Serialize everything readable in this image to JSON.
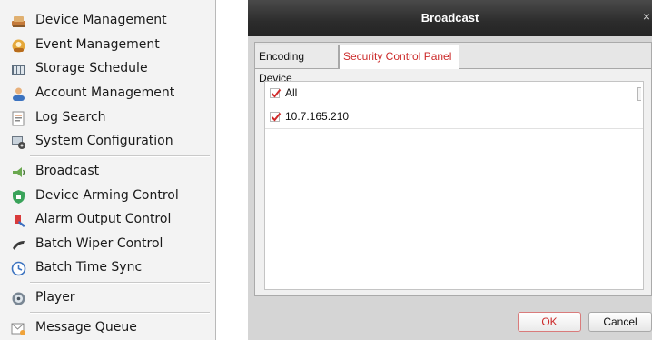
{
  "menu": {
    "items": [
      {
        "label": "Device Management",
        "icon": "device-management-icon"
      },
      {
        "label": "Event Management",
        "icon": "event-management-icon"
      },
      {
        "label": "Storage Schedule",
        "icon": "storage-schedule-icon"
      },
      {
        "label": "Account Management",
        "icon": "account-management-icon"
      },
      {
        "label": "Log Search",
        "icon": "log-search-icon"
      },
      {
        "label": "System Configuration",
        "icon": "system-configuration-icon"
      },
      {
        "label": "Broadcast",
        "icon": "broadcast-icon"
      },
      {
        "label": "Device Arming Control",
        "icon": "device-arming-icon"
      },
      {
        "label": "Alarm Output Control",
        "icon": "alarm-output-icon"
      },
      {
        "label": "Batch Wiper Control",
        "icon": "wiper-icon"
      },
      {
        "label": "Batch Time Sync",
        "icon": "clock-icon"
      },
      {
        "label": "Player",
        "icon": "player-icon"
      },
      {
        "label": "Message Queue",
        "icon": "message-queue-icon"
      }
    ]
  },
  "dialog": {
    "title": "Broadcast",
    "close_glyph": "×",
    "tabs": [
      {
        "label": "Encoding Device",
        "active": false
      },
      {
        "label": "Security Control Panel",
        "active": true
      }
    ],
    "list": [
      {
        "label": "All",
        "checked": true
      },
      {
        "label": "10.7.165.210",
        "checked": true
      }
    ],
    "ok_label": "OK",
    "cancel_label": "Cancel"
  },
  "colors": {
    "accent_red": "#cc2a2a",
    "titlebar": "#2c2c2c",
    "menu_bg": "#f3f3f3"
  }
}
